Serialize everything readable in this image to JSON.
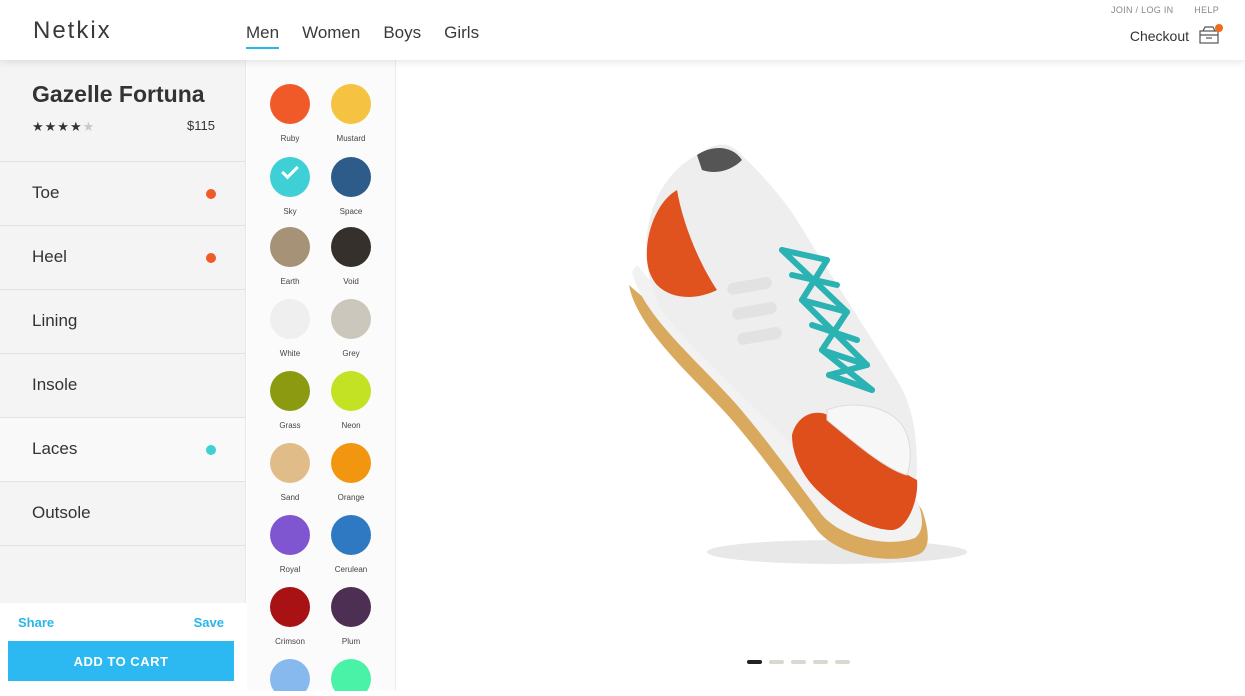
{
  "header": {
    "logo": "Netkix",
    "nav": [
      "Men",
      "Women",
      "Boys",
      "Girls"
    ],
    "active_nav": "Men",
    "join_login": "JOIN / LOG IN",
    "help": "HELP",
    "checkout": "Checkout"
  },
  "product": {
    "name": "Gazelle Fortuna",
    "rating": 4,
    "rating_max": 5,
    "stars_filled": "★★★★",
    "stars_empty": "★",
    "price": "$115"
  },
  "parts": [
    {
      "label": "Toe",
      "dot": "#f05a28"
    },
    {
      "label": "Heel",
      "dot": "#f05a28"
    },
    {
      "label": "Lining",
      "dot": ""
    },
    {
      "label": "Insole",
      "dot": ""
    },
    {
      "label": "Laces",
      "dot": "#3fd0d6"
    },
    {
      "label": "Outsole",
      "dot": ""
    }
  ],
  "actions": {
    "share": "Share",
    "save": "Save",
    "add_to_cart": "ADD TO CART"
  },
  "swatches": [
    {
      "name": "Ruby",
      "color": "#f05a28"
    },
    {
      "name": "Mustard",
      "color": "#f5c242"
    },
    {
      "name": "Sky",
      "color": "#3fd0d6",
      "selected": true
    },
    {
      "name": "Space",
      "color": "#2d5b8a"
    },
    {
      "name": "Earth",
      "color": "#a69276"
    },
    {
      "name": "Void",
      "color": "#35302b"
    },
    {
      "name": "White",
      "color": "#efefef"
    },
    {
      "name": "Grey",
      "color": "#cbc7bc"
    },
    {
      "name": "Grass",
      "color": "#8c9a12"
    },
    {
      "name": "Neon",
      "color": "#c4e224"
    },
    {
      "name": "Sand",
      "color": "#e0bc88"
    },
    {
      "name": "Orange",
      "color": "#f29610"
    },
    {
      "name": "Royal",
      "color": "#7f55d0"
    },
    {
      "name": "Cerulean",
      "color": "#2f79c2"
    },
    {
      "name": "Crimson",
      "color": "#a81214"
    },
    {
      "name": "Plum",
      "color": "#4c2f52"
    },
    {
      "name": "",
      "color": "#88b9ee"
    },
    {
      "name": "",
      "color": "#4af2a8"
    }
  ],
  "carousel": {
    "count": 5,
    "active": 1
  }
}
